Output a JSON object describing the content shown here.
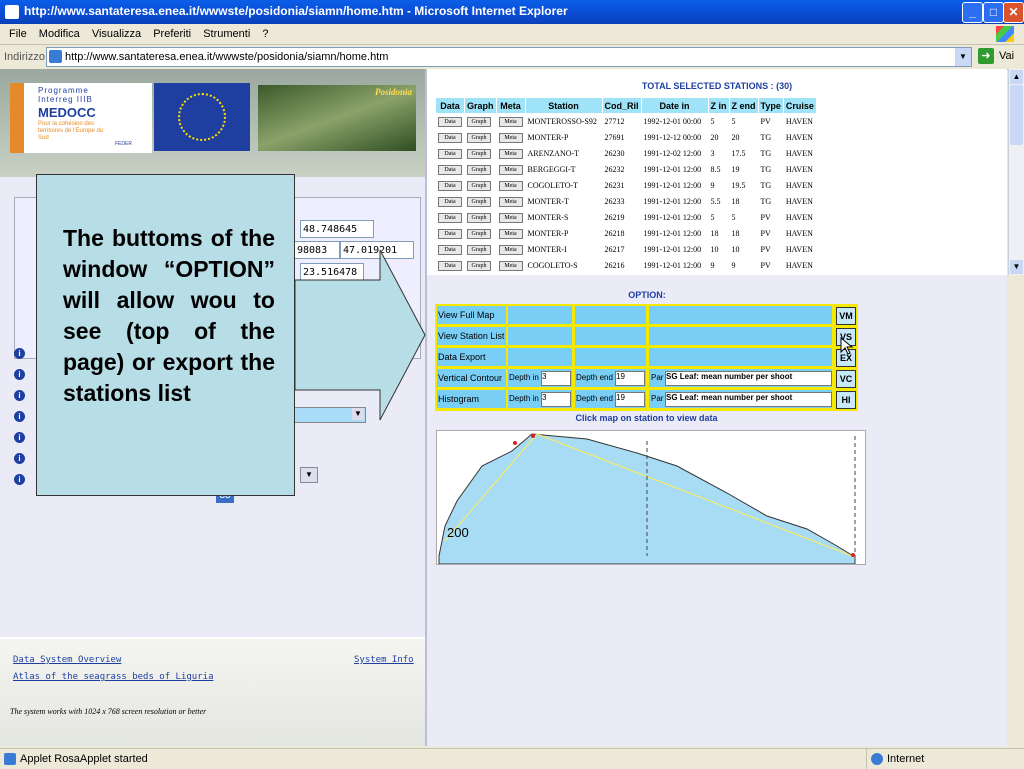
{
  "window": {
    "title": "http://www.santateresa.enea.it/wwwste/posidonia/siamn/home.htm - Microsoft Internet Explorer"
  },
  "menu": [
    "File",
    "Modifica",
    "Visualizza",
    "Preferiti",
    "Strumenti",
    "?"
  ],
  "address": {
    "label": "Indirizzo",
    "url": "http://www.santateresa.enea.it/wwwste/posidonia/siamn/home.htm",
    "go_label": "Vai"
  },
  "logos": {
    "programme": "Programme",
    "interreg": "Interreg IIIB",
    "medocc": "MEDOCC",
    "tag": "Pour la cohésion des territoires de l'Europe du Sud",
    "feder": "FEDER",
    "posidonia": "Posidonia"
  },
  "left_inputs": [
    "48.748645",
    "98083",
    "47.019201",
    "23.516478"
  ],
  "left_button": "GO",
  "footer": {
    "overview": "Data System Overview",
    "system_info": "System Info",
    "atlas": "Atlas of the seagrass beds of Liguria",
    "note": "The system works with 1024 x 768 screen resolution or better"
  },
  "callout": {
    "text": "The buttoms of the window “OPTION” will allow wou to see (top of the page) or export the stations list"
  },
  "stations": {
    "title": "TOTAL SELECTED STATIONS : (30)",
    "headers": [
      "Data",
      "Graph",
      "Meta",
      "Station",
      "Cod_Ril",
      "Date in",
      "Z in",
      "Z end",
      "Type",
      "Cruise"
    ],
    "btn_data": "Data",
    "btn_graph": "Graph",
    "btn_meta": "Meta",
    "rows": [
      [
        "MONTEROSSO-S92",
        "27712",
        "1992-12-01 00:00",
        "5",
        "5",
        "PV",
        "HAVEN"
      ],
      [
        "MONTER-P",
        "27691",
        "1991-12-12 00:00",
        "20",
        "20",
        "TG",
        "HAVEN"
      ],
      [
        "ARENZANO-T",
        "26230",
        "1991-12-02 12:00",
        "3",
        "17.5",
        "TG",
        "HAVEN"
      ],
      [
        "BERGEGGI-T",
        "26232",
        "1991-12-01 12:00",
        "8.5",
        "19",
        "TG",
        "HAVEN"
      ],
      [
        "COGOLETO-T",
        "26231",
        "1991-12-01 12:00",
        "9",
        "19.5",
        "TG",
        "HAVEN"
      ],
      [
        "MONTER-T",
        "26233",
        "1991-12-01 12:00",
        "5.5",
        "18",
        "TG",
        "HAVEN"
      ],
      [
        "MONTER-S",
        "26219",
        "1991-12-01 12:00",
        "5",
        "5",
        "PV",
        "HAVEN"
      ],
      [
        "MONTER-P",
        "26218",
        "1991-12-01 12:00",
        "18",
        "18",
        "PV",
        "HAVEN"
      ],
      [
        "MONTER-I",
        "26217",
        "1991-12-01 12:00",
        "10",
        "10",
        "PV",
        "HAVEN"
      ],
      [
        "COGOLETO-S",
        "26216",
        "1991-12-01 12:00",
        "9",
        "9",
        "PV",
        "HAVEN"
      ]
    ]
  },
  "option": {
    "title": "OPTION:",
    "rows": [
      "View Full Map",
      "View Station List",
      "Data Export",
      "Vertical Contour",
      "Histogram"
    ],
    "buttons": [
      "VM",
      "VS",
      "EX",
      "VC",
      "HI"
    ],
    "depth_in_label": "Depth in",
    "depth_end_label": "Depth end",
    "par_label": "Par",
    "depth_in": "3",
    "depth_end": "19",
    "par_value": "SG Leaf: mean number per shoot",
    "click_hint": "Click map on station to view data"
  },
  "map": {
    "depth_label": "200"
  },
  "status": {
    "left": "Applet RosaApplet started",
    "zone": "Internet"
  }
}
